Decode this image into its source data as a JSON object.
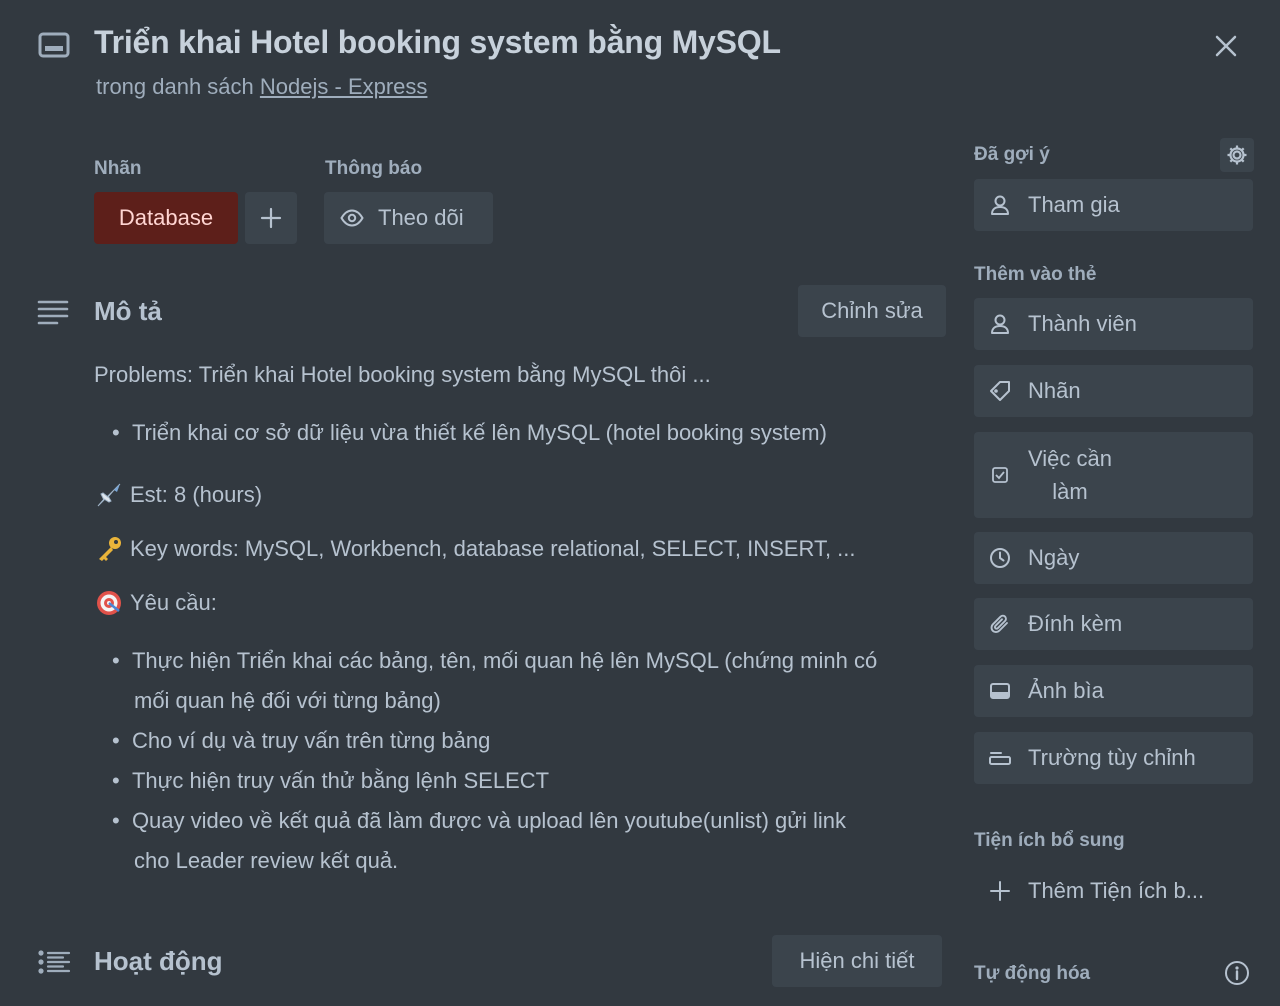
{
  "header": {
    "title": "Triển khai Hotel booking system bằng MySQL",
    "subtitle_prefix": "trong danh sách",
    "list_name": "Nodejs - Express",
    "icons": {
      "card": "card-icon",
      "close": "close-icon"
    }
  },
  "labels": {
    "heading": "Nhãn",
    "chip": "Database",
    "chip_color": "#5d1f1a",
    "add_icon": "plus-icon"
  },
  "notifications": {
    "heading": "Thông báo",
    "watch_label": "Theo dõi",
    "watch_icon": "eye-icon"
  },
  "description": {
    "heading": "Mô tả",
    "edit_label": "Chỉnh sửa",
    "problems": "Problems: Triển khai Hotel booking system bằng MySQL thôi ...",
    "bullet1": "Triển khai cơ sở dữ liệu vừa thiết kế lên MySQL (hotel booking system)",
    "est": "Est: 8 (hours)",
    "keywords": "Key words: MySQL, Workbench, database relational, SELECT, INSERT, ...",
    "requirements_heading": "Yêu cầu:",
    "requirements": [
      "Thực hiện Triển khai các bảng, tên, mối quan hệ lên MySQL (chứng minh có",
      "mối quan hệ đối với từng bảng)",
      "Cho ví dụ và truy vấn trên từng bảng",
      "Thực hiện truy vấn thử bằng lệnh SELECT",
      "Quay video về kết quả đã làm được và upload lên youtube(unlist) gửi link",
      "cho Leader review kết quả."
    ],
    "emoji_icons": [
      "airplane-icon",
      "key-icon",
      "target-icon"
    ]
  },
  "activity": {
    "heading": "Hoạt động",
    "details_label": "Hiện chi tiết"
  },
  "sidebar": {
    "suggested_heading": "Đã gợi ý",
    "join_label": "Tham gia",
    "add_to_card_heading": "Thêm vào thẻ",
    "buttons": {
      "members": "Thành viên",
      "labels": "Nhãn",
      "checklist_line1": "Việc cần",
      "checklist_line2": "làm",
      "dates": "Ngày",
      "attachment": "Đính kèm",
      "cover": "Ảnh bìa",
      "custom_fields": "Trường tùy chỉnh"
    },
    "powerups_heading": "Tiện ích bổ sung",
    "add_powerups": "Thêm Tiện ích b...",
    "automation_heading": "Tự động hóa"
  },
  "colors": {
    "background": "#323940",
    "button": "#3b444c",
    "text": "#b6c2cf"
  }
}
